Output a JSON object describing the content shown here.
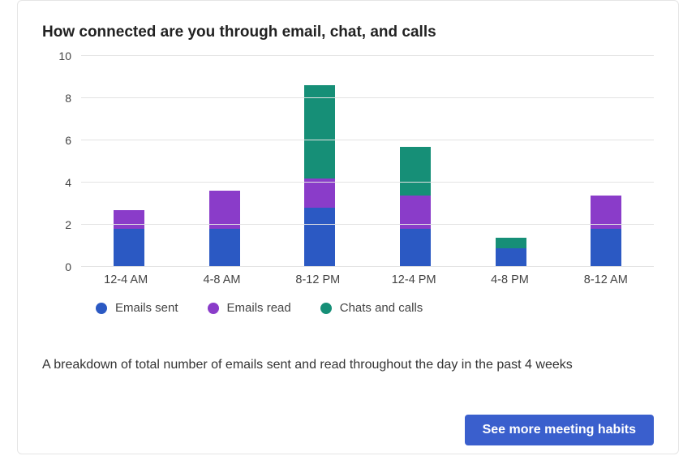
{
  "title": "How connected are you through email, chat, and calls",
  "chart_data": {
    "type": "bar",
    "stacked": true,
    "categories": [
      "12-4 AM",
      "4-8 AM",
      "8-12 PM",
      "12-4 PM",
      "4-8 PM",
      "8-12 AM"
    ],
    "series": [
      {
        "name": "Emails sent",
        "color": "#2b59c3",
        "values": [
          1.8,
          1.8,
          2.8,
          1.8,
          0.9,
          1.8
        ]
      },
      {
        "name": "Emails read",
        "color": "#8a3cc9",
        "values": [
          0.9,
          1.8,
          1.4,
          1.6,
          0.0,
          1.6
        ]
      },
      {
        "name": "Chats and calls",
        "color": "#168f77",
        "values": [
          0.0,
          0.0,
          4.4,
          2.3,
          0.5,
          0.0
        ]
      }
    ],
    "ylim": [
      0,
      10
    ],
    "yticks": [
      0,
      2,
      4,
      6,
      8,
      10
    ],
    "ylabel": "",
    "xlabel": ""
  },
  "legend": {
    "items": [
      {
        "label": "Emails sent",
        "color": "#2b59c3"
      },
      {
        "label": "Emails read",
        "color": "#8a3cc9"
      },
      {
        "label": "Chats and calls",
        "color": "#168f77"
      }
    ]
  },
  "description": "A breakdown of total number of emails sent and read throughout the day in the past 4 weeks",
  "cta_label": "See more meeting habits"
}
